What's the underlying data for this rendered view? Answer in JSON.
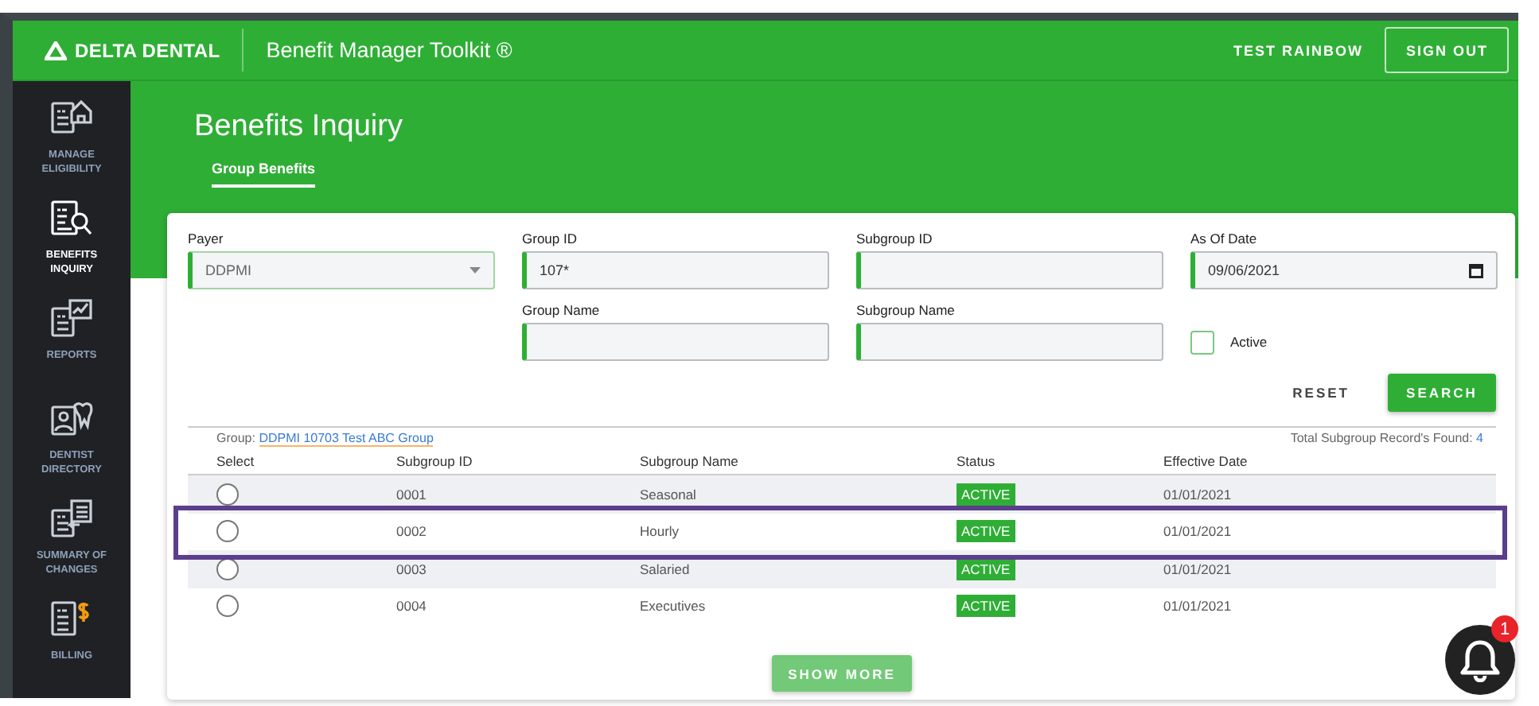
{
  "header": {
    "brand": "DELTA DENTAL",
    "app_title": "Benefit Manager Toolkit ®",
    "user": "TEST RAINBOW",
    "sign_out": "SIGN OUT"
  },
  "sidebar": {
    "items": [
      {
        "label": "MANAGE ELIGIBILITY",
        "selected": false
      },
      {
        "label": "BENEFITS INQUIRY",
        "selected": true
      },
      {
        "label": "REPORTS",
        "selected": false
      },
      {
        "label": "DENTIST DIRECTORY",
        "selected": false
      },
      {
        "label": "SUMMARY OF CHANGES",
        "selected": false
      },
      {
        "label": "BILLING",
        "selected": false
      }
    ]
  },
  "page": {
    "title": "Benefits Inquiry",
    "tabs": [
      {
        "label": "Group Benefits",
        "selected": true
      }
    ]
  },
  "form": {
    "fields": [
      {
        "kind": "select",
        "label": "Payer",
        "value": "DDPMI"
      },
      {
        "kind": "text",
        "label": "Group ID",
        "value": "107*"
      },
      {
        "kind": "text",
        "label": "Subgroup ID"
      },
      {
        "kind": "date",
        "label": "As Of Date",
        "value": "09/06/2021"
      },
      {
        "kind": "spacer"
      },
      {
        "kind": "text",
        "label": "Group Name"
      },
      {
        "kind": "text",
        "label": "Subgroup Name"
      },
      {
        "kind": "checkbox",
        "label": "Active",
        "checked": false
      }
    ],
    "reset": "RESET",
    "search": "SEARCH"
  },
  "results": {
    "group_label": "Group:",
    "group_link": "DDPMI 10703 Test ABC Group",
    "total_label": "Total Subgroup Record's Found:",
    "total_count": "4",
    "columns": [
      "Select",
      "Subgroup ID",
      "Subgroup Name",
      "Status",
      "Effective Date"
    ],
    "rows": [
      {
        "selected": false,
        "highlighted": false,
        "subgroup_id": "0001",
        "subgroup_name": "Seasonal",
        "status": "ACTIVE",
        "effective_date": "01/01/2021"
      },
      {
        "selected": false,
        "highlighted": true,
        "subgroup_id": "0002",
        "subgroup_name": "Hourly",
        "status": "ACTIVE",
        "effective_date": "01/01/2021"
      },
      {
        "selected": false,
        "highlighted": false,
        "subgroup_id": "0003",
        "subgroup_name": "Salaried",
        "status": "ACTIVE",
        "effective_date": "01/01/2021"
      },
      {
        "selected": false,
        "highlighted": false,
        "subgroup_id": "0004",
        "subgroup_name": "Executives",
        "status": "ACTIVE",
        "effective_date": "01/01/2021"
      }
    ],
    "show_more": "SHOW MORE"
  },
  "notifications": {
    "count": "1"
  }
}
